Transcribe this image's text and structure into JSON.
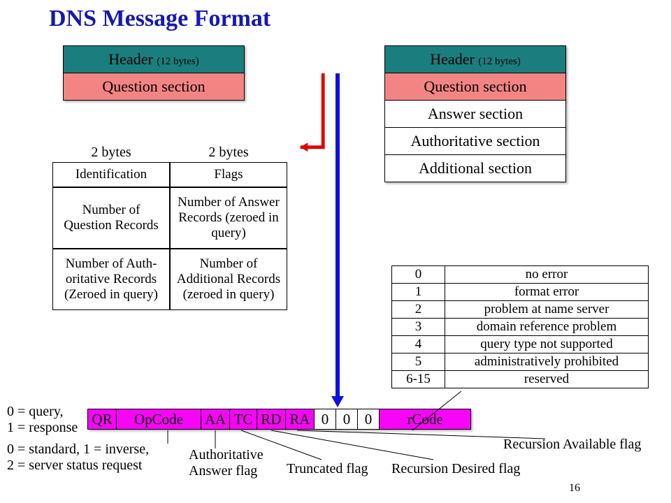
{
  "title": "DNS Message Format",
  "pagenum": "16",
  "msg_query": {
    "header": "Header ",
    "header_sub": "(12 bytes)",
    "question": "Question section"
  },
  "msg_resp": {
    "header": "Header ",
    "header_sub": "(12 bytes)",
    "question": "Question section",
    "answer": "Answer section",
    "auth": "Authoritative section",
    "addl": "Additional section"
  },
  "hdr_fields": {
    "col1": "2 bytes",
    "col2": "2 bytes",
    "r0c0": "Identification",
    "r0c1": "Flags",
    "r1c0": "Number of Question Records",
    "r1c1": "Number of Answer Records (zeroed in query)",
    "r2c0": "Number of Auth-oritative Records (Zeroed in query)",
    "r2c1": "Number of Additional Records (zeroed in query)"
  },
  "rcode": {
    "rows": [
      {
        "code": "0",
        "desc": "no error"
      },
      {
        "code": "1",
        "desc": "format error"
      },
      {
        "code": "2",
        "desc": "problem at name server"
      },
      {
        "code": "3",
        "desc": "domain reference problem"
      },
      {
        "code": "4",
        "desc": "query type not supported"
      },
      {
        "code": "5",
        "desc": "administratively prohibited"
      },
      {
        "code": "6-15",
        "desc": "reserved"
      }
    ]
  },
  "flags": {
    "QR": "QR",
    "OpCode": "OpCode",
    "AA": "AA",
    "TC": "TC",
    "RD": "RD",
    "RA": "RA",
    "z0": "0",
    "z1": "0",
    "z2": "0",
    "rCode": "rCode"
  },
  "notes": {
    "qr": "0 = query,\n1 = response",
    "opcode": "0 = standard, 1 = inverse,\n2 = server status request",
    "aa": "Authoritative\nAnswer flag",
    "tc": "Truncated flag",
    "rd": "Recursion Desired flag",
    "ra": "Recursion Available flag"
  }
}
